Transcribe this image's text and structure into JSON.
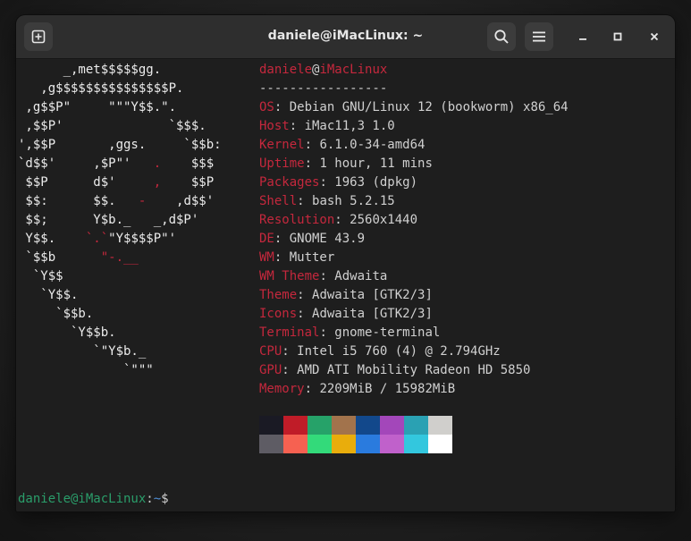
{
  "window": {
    "title": "daniele@iMacLinux: ~",
    "icons": {
      "new_tab": "new-tab-icon",
      "search": "search-icon",
      "menu": "hamburger-menu-icon",
      "minimize": "minimize-icon",
      "maximize": "maximize-icon",
      "close": "close-icon"
    }
  },
  "logo_lines": [
    "      _,met$$$$$gg.",
    "   ,g$$$$$$$$$$$$$$$P.",
    " ,g$$P\"     \"\"\"Y$$.\".",
    " ,$$P'              `$$$.",
    "',$$P       ,ggs.     `$$b:",
    "`d$$'     ,$P\"'   ",
    " $$P      d$'     ",
    " $$:      $$.   ",
    " $$;      Y$b._   _,d$P'",
    " Y$$.    ",
    " `$$b      ",
    "  `Y$$",
    "   `Y$$.",
    "     `$$b.",
    "       `Y$$b.",
    "          `\"Y$b._",
    "              `\"\"\""
  ],
  "logo_segments": {
    "l6_dot": ".",
    "l6_end": "    $$$",
    "l7_comma": ",",
    "l7_end": "    $$P",
    "l8_dash": "-",
    "l8_end": "    ,d$$'",
    "l10_red": "`.`",
    "l10_end": "\"Y$$$$P\"'",
    "l11_red": "\"-.__"
  },
  "user": "daniele",
  "at": "@",
  "host": "iMacLinux",
  "divider": "-----------------",
  "info": [
    {
      "key": "OS",
      "value": "Debian GNU/Linux 12 (bookworm) x86_64"
    },
    {
      "key": "Host",
      "value": "iMac11,3 1.0"
    },
    {
      "key": "Kernel",
      "value": "6.1.0-34-amd64"
    },
    {
      "key": "Uptime",
      "value": "1 hour, 11 mins"
    },
    {
      "key": "Packages",
      "value": "1963 (dpkg)"
    },
    {
      "key": "Shell",
      "value": "bash 5.2.15"
    },
    {
      "key": "Resolution",
      "value": "2560x1440"
    },
    {
      "key": "DE",
      "value": "GNOME 43.9"
    },
    {
      "key": "WM",
      "value": "Mutter"
    },
    {
      "key": "WM Theme",
      "value": "Adwaita"
    },
    {
      "key": "Theme",
      "value": "Adwaita [GTK2/3]"
    },
    {
      "key": "Icons",
      "value": "Adwaita [GTK2/3]"
    },
    {
      "key": "Terminal",
      "value": "gnome-terminal"
    },
    {
      "key": "CPU",
      "value": "Intel i5 760 (4) @ 2.794GHz"
    },
    {
      "key": "GPU",
      "value": "AMD ATI Mobility Radeon HD 5850"
    },
    {
      "key": "Memory",
      "value": "2209MiB / 15982MiB"
    }
  ],
  "palette_top": [
    "#1a1a24",
    "#c01c28",
    "#26a269",
    "#a2734c",
    "#12488b",
    "#a347ba",
    "#2aa1b3",
    "#d0cfcc"
  ],
  "palette_bottom": [
    "#5e5c64",
    "#f66151",
    "#33da7a",
    "#e9ad0c",
    "#2a7bde",
    "#c061cb",
    "#33c7de",
    "#ffffff"
  ],
  "prompt": {
    "user_host": "daniele@iMacLinux",
    "colon": ":",
    "path": "~",
    "symbol": "$"
  }
}
